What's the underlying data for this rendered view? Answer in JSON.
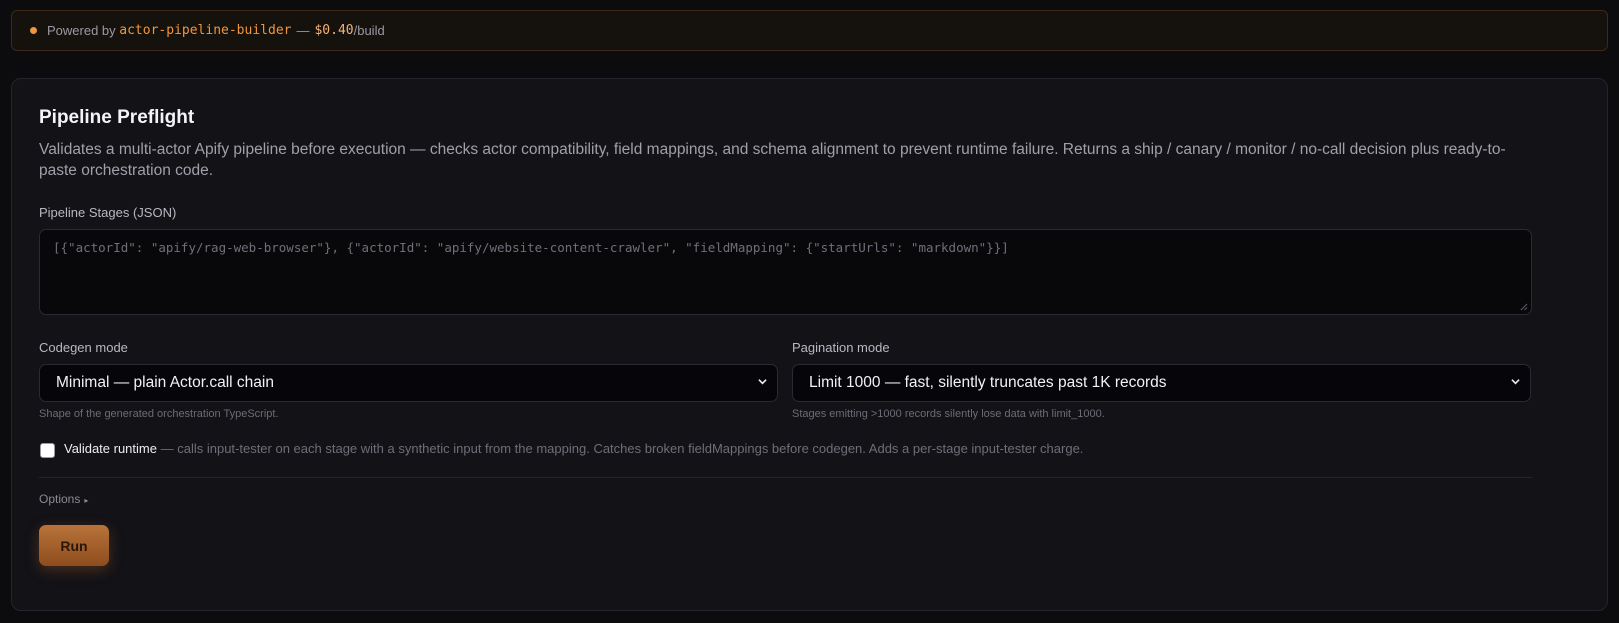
{
  "banner": {
    "prefix": "Powered by",
    "builder": "actor-pipeline-builder",
    "separator": "—",
    "price": "$0.40",
    "suffix": "/build",
    "accent_color": "#f0953b"
  },
  "form": {
    "title": "Pipeline Preflight",
    "description": "Validates a multi-actor Apify pipeline before execution — checks actor compatibility, field mappings, and schema alignment to prevent runtime failure. Returns a ship / canary / monitor / no-call decision plus ready-to-paste orchestration code.",
    "stages": {
      "label": "Pipeline Stages (JSON)",
      "placeholder": "[{\"actorId\": \"apify/rag-web-browser\"}, {\"actorId\": \"apify/website-content-crawler\", \"fieldMapping\": {\"startUrls\": \"markdown\"}}]"
    },
    "codegen": {
      "label": "Codegen mode",
      "value": "Minimal — plain Actor.call chain",
      "hint": "Shape of the generated orchestration TypeScript."
    },
    "pagination": {
      "label": "Pagination mode",
      "value": "Limit 1000 — fast, silently truncates past 1K records",
      "hint": "Stages emitting >1000 records silently lose data with limit_1000."
    },
    "validate_runtime": {
      "label": "Validate runtime",
      "checked": false,
      "description": "— calls input-tester on each stage with a synthetic input from the mapping. Catches broken fieldMappings before codegen. Adds a per-stage input-tester charge."
    },
    "options_label": "Options",
    "options_icon": "triangle-right-icon",
    "run_label": "Run"
  }
}
